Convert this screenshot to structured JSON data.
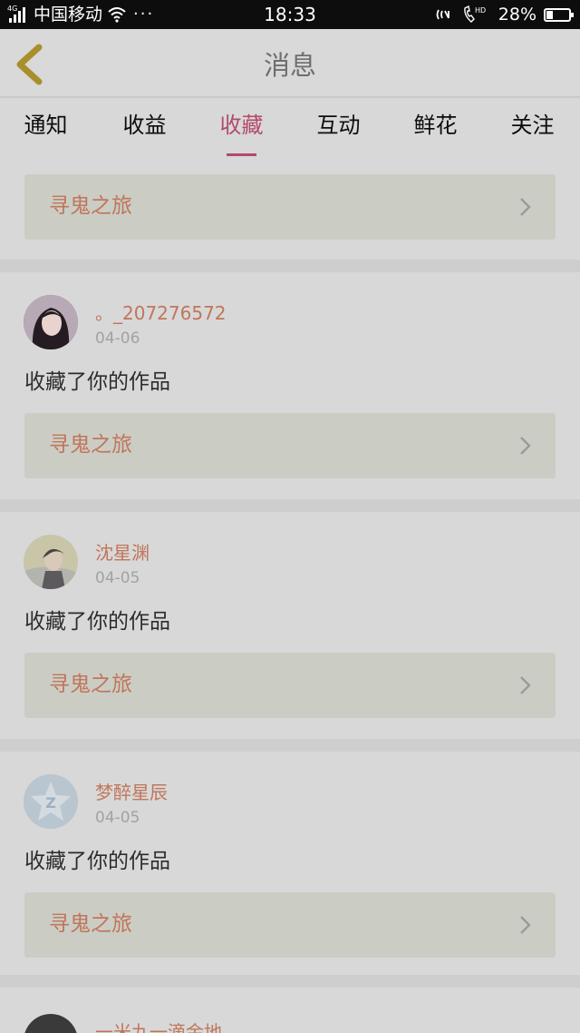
{
  "status_bar": {
    "network_type": "4G",
    "carrier": "中国移动",
    "more": "···",
    "time": "18:33",
    "hd_label": "HD",
    "battery_percent": "28%",
    "battery_level": 0.28
  },
  "header": {
    "title": "消息"
  },
  "tabs": [
    {
      "label": "通知"
    },
    {
      "label": "收益"
    },
    {
      "label": "收藏"
    },
    {
      "label": "互动"
    },
    {
      "label": "鲜花"
    },
    {
      "label": "关注"
    }
  ],
  "active_tab": "收藏",
  "top_item": {
    "work_title": "寻鬼之旅"
  },
  "items": [
    {
      "username": "。_207276572",
      "date": "04-06",
      "action": "收藏了你的作品",
      "work_title": "寻鬼之旅"
    },
    {
      "username": "沈星渊",
      "date": "04-05",
      "action": "收藏了你的作品",
      "work_title": "寻鬼之旅"
    },
    {
      "username": "梦醉星辰",
      "date": "04-05",
      "action": "收藏了你的作品",
      "work_title": "寻鬼之旅"
    },
    {
      "username": "一米九一滴金地"
    }
  ],
  "colors": {
    "accent": "#b34a6a",
    "username": "#c0765a",
    "work_box": "#cbcdc5",
    "page_bg": "#d8d8d8"
  }
}
